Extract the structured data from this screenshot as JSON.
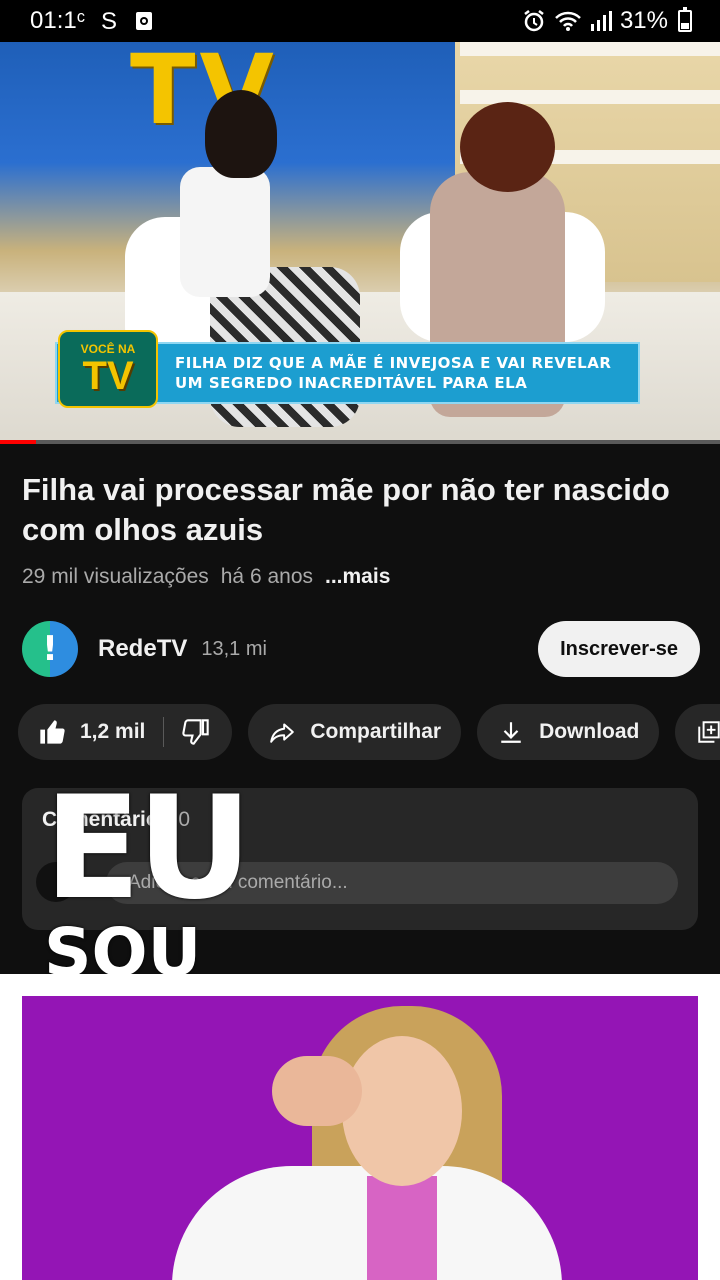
{
  "status_bar": {
    "time": "01:1ᶜ",
    "left_icons": [
      "s-icon",
      "media-icon"
    ],
    "battery": "31%",
    "right_icons": [
      "alarm-icon",
      "wifi-icon",
      "signal-icon",
      "battery-icon"
    ]
  },
  "video": {
    "lower_third_line1": "FILHA DIZ QUE A MÃE É INVEJOSA E VAI REVELAR",
    "lower_third_line2": "UM SEGREDO INACREDITÁVEL PARA ELA",
    "logo_line1": "VOCÊ NA",
    "logo_line2": "TV",
    "backdrop_letters": "TV",
    "progress_fraction": 0.05
  },
  "title": "Filha vai processar mãe por não ter nascido com olhos azuis",
  "meta": {
    "views": "29 mil visualizações",
    "age": "há 6 anos",
    "more": "...mais"
  },
  "channel": {
    "name": "RedeTV",
    "subscribers": "13,1 mi",
    "subscribe_label": "Inscrever-se",
    "avatar_glyph": "!"
  },
  "actions": {
    "likes": "1,2 mil",
    "share_label": "Compartilhar",
    "download_label": "Download"
  },
  "comments": {
    "heading": "Comentários",
    "count": "0",
    "placeholder": "Adicione um comentário..."
  },
  "overlay": {
    "line1": "EU",
    "line2": "SOU"
  },
  "colors": {
    "background": "#0f0f0f",
    "pill": "#272727",
    "subscribe": "#f1f1f1",
    "promo": "#9415b5",
    "progress": "#ff0000"
  }
}
